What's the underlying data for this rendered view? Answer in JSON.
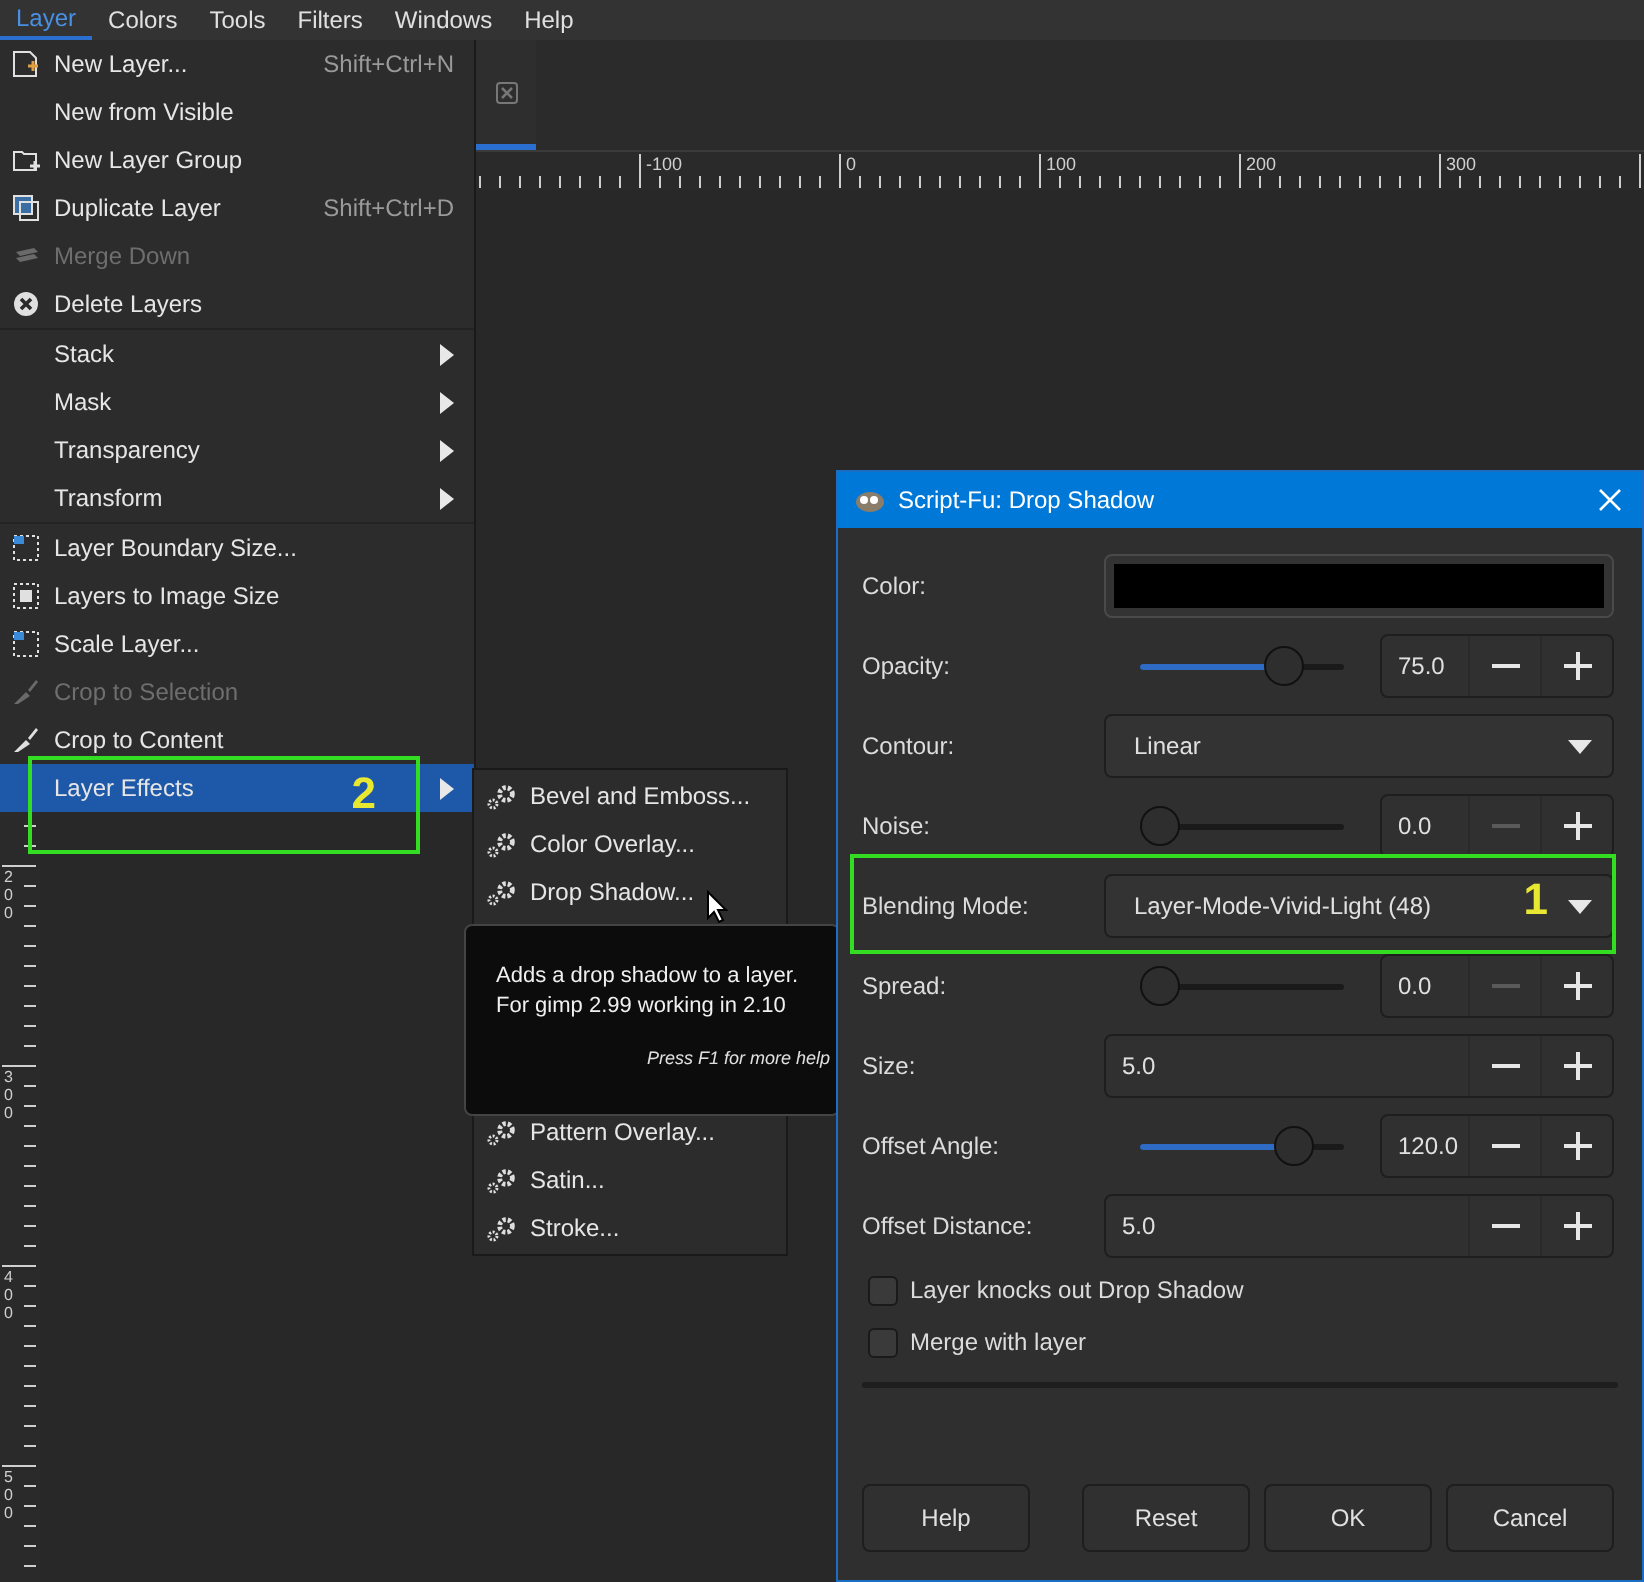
{
  "menubar": [
    {
      "label": "Layer",
      "selected": true
    },
    {
      "label": "Colors",
      "selected": false
    },
    {
      "label": "Tools",
      "selected": false
    },
    {
      "label": "Filters",
      "selected": false
    },
    {
      "label": "Windows",
      "selected": false
    },
    {
      "label": "Help",
      "selected": false
    }
  ],
  "ruler": {
    "x_labels": [
      "-100",
      "0",
      "100",
      "200",
      "300"
    ],
    "y_labels": [
      "200",
      "300",
      "400",
      "500"
    ]
  },
  "layer_menu": [
    {
      "kind": "item",
      "label": "New Layer...",
      "shortcut": "Shift+Ctrl+N",
      "disabled": false,
      "submenu": false,
      "selected": false
    },
    {
      "kind": "item",
      "label": "New from Visible",
      "disabled": false,
      "submenu": false,
      "selected": false
    },
    {
      "kind": "item",
      "label": "New Layer Group",
      "disabled": false,
      "submenu": false,
      "selected": false
    },
    {
      "kind": "item",
      "label": "Duplicate Layer",
      "shortcut": "Shift+Ctrl+D",
      "disabled": false,
      "submenu": false,
      "selected": false
    },
    {
      "kind": "item",
      "label": "Merge Down",
      "disabled": true,
      "submenu": false,
      "selected": false
    },
    {
      "kind": "item",
      "label": "Delete Layers",
      "disabled": false,
      "submenu": false,
      "selected": false
    },
    {
      "kind": "separator"
    },
    {
      "kind": "item",
      "label": "Stack",
      "disabled": false,
      "submenu": true,
      "selected": false
    },
    {
      "kind": "item",
      "label": "Mask",
      "disabled": false,
      "submenu": true,
      "selected": false
    },
    {
      "kind": "item",
      "label": "Transparency",
      "disabled": false,
      "submenu": true,
      "selected": false
    },
    {
      "kind": "item",
      "label": "Transform",
      "disabled": false,
      "submenu": true,
      "selected": false
    },
    {
      "kind": "separator"
    },
    {
      "kind": "item",
      "label": "Layer Boundary Size...",
      "disabled": false,
      "submenu": false,
      "selected": false
    },
    {
      "kind": "item",
      "label": "Layers to Image Size",
      "disabled": false,
      "submenu": false,
      "selected": false
    },
    {
      "kind": "item",
      "label": "Scale Layer...",
      "disabled": false,
      "submenu": false,
      "selected": false
    },
    {
      "kind": "item",
      "label": "Crop to Selection",
      "disabled": true,
      "submenu": false,
      "selected": false
    },
    {
      "kind": "item",
      "label": "Crop to Content",
      "disabled": false,
      "submenu": false,
      "selected": false
    },
    {
      "kind": "item",
      "label": "Layer Effects",
      "disabled": false,
      "submenu": true,
      "selected": true
    }
  ],
  "effects_submenu_top": [
    {
      "label": "Bevel and Emboss..."
    },
    {
      "label": "Color Overlay..."
    },
    {
      "label": "Drop Shadow..."
    }
  ],
  "effects_submenu_bottom": [
    {
      "label": "Pattern Overlay..."
    },
    {
      "label": "Satin..."
    },
    {
      "label": "Stroke..."
    }
  ],
  "tooltip": {
    "text": [
      "Adds a drop shadow to a layer.",
      "For gimp 2.99 working in 2.10"
    ],
    "hint": "Press F1 for more help"
  },
  "dialog": {
    "title": "Script-Fu: Drop Shadow",
    "rows": [
      {
        "kind": "color",
        "label": "Color:",
        "color": "#000000"
      },
      {
        "kind": "slider",
        "label": "Opacity:",
        "level": 0.75,
        "value": "75.0",
        "minus_disabled": false
      },
      {
        "kind": "select",
        "label": "Contour:",
        "value": "Linear"
      },
      {
        "kind": "slider",
        "label": "Noise:",
        "level": 0,
        "value": "0.0",
        "minus_disabled": true
      },
      {
        "kind": "select",
        "label": "Blending Mode:",
        "value": "Layer-Mode-Vivid-Light (48)"
      },
      {
        "kind": "slider",
        "label": "Spread:",
        "level": 0,
        "value": "0.0",
        "minus_disabled": true
      },
      {
        "kind": "entry",
        "label": "Size:",
        "value": "5.0",
        "minus_disabled": false
      },
      {
        "kind": "slider",
        "label": "Offset Angle:",
        "level": 0.82,
        "value": "120.0",
        "minus_disabled": false
      },
      {
        "kind": "entry",
        "label": "Offset Distance:",
        "value": "5.0",
        "minus_disabled": false
      }
    ],
    "checkboxes": [
      {
        "label": "Layer knocks out Drop Shadow",
        "checked": false
      },
      {
        "label": "Merge with layer",
        "checked": false
      }
    ],
    "buttons": [
      "Help",
      "Reset",
      "OK",
      "Cancel"
    ]
  },
  "annotations": [
    "2",
    "1"
  ]
}
